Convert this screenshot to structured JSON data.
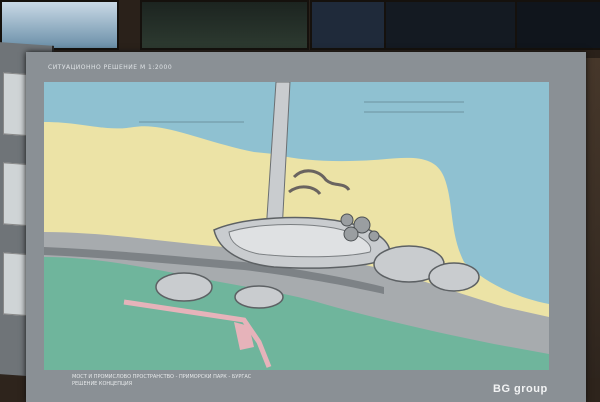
{
  "board": {
    "header": "СИТУАЦИОННО РЕШЕНИЕ   M 1:2000",
    "footer_title": "МОСТ И ПРОМИСЛОВО ПРОСТРАНСТВО - ПРИМОРСКИ ПАРК - БУРГАС",
    "footer_subtitle": "РЕШЕНИЕ КОНЦЕПЦИЯ",
    "brand": "BG group",
    "colors": {
      "sea": "#8fc1d1",
      "sand": "#ece3a6",
      "green": "#6fb59c",
      "structure": "#c9cccf",
      "board": "#8a9095"
    }
  }
}
